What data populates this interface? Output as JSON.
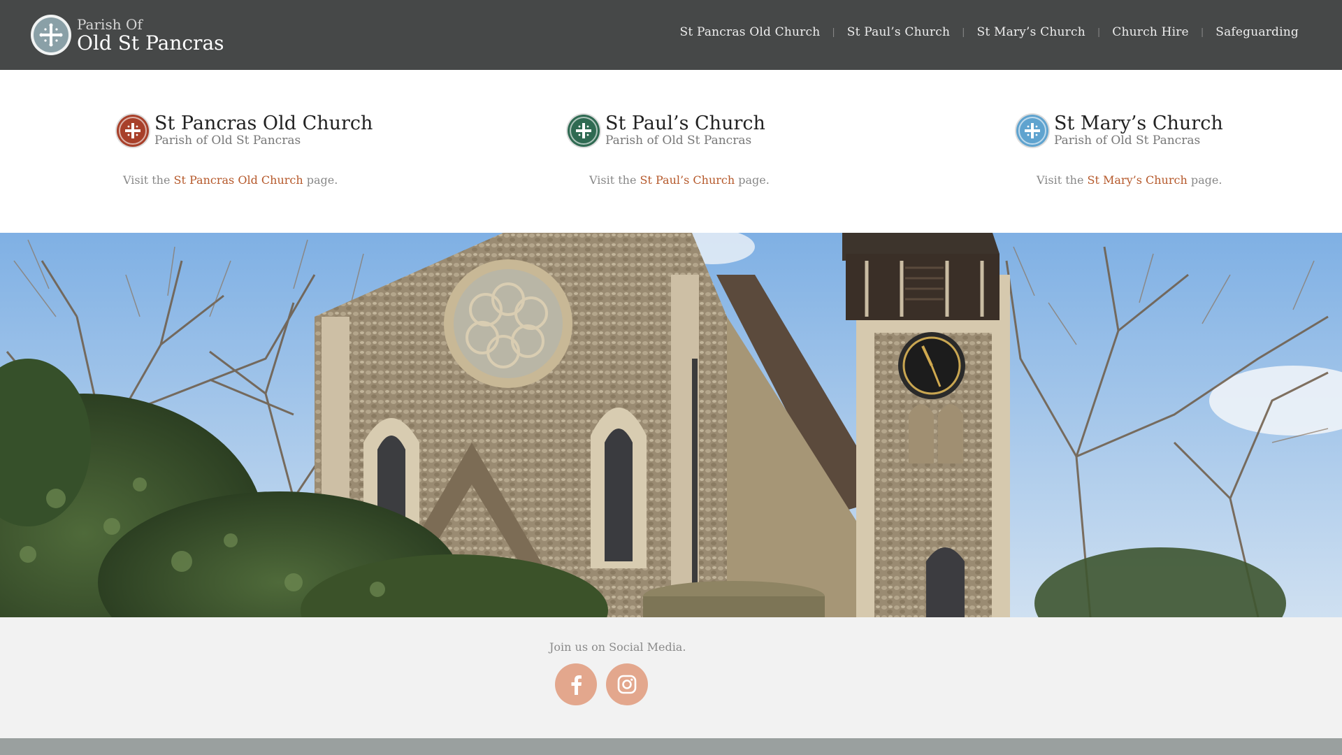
{
  "header": {
    "brand_small": "Parish Of",
    "brand_big": "Old St Pancras",
    "nav": [
      {
        "label": "St Pancras Old Church"
      },
      {
        "label": "St Paul’s Church"
      },
      {
        "label": "St Mary’s Church"
      },
      {
        "label": "Church Hire"
      },
      {
        "label": "Safeguarding"
      }
    ],
    "separator": "|"
  },
  "churches": [
    {
      "title": "St Pancras Old Church",
      "subtitle": "Parish of Old St Pancras",
      "visit_prefix": "Visit the",
      "link": "St Pancras Old Church",
      "visit_suffix": "page.",
      "badge_color": "#a8402a",
      "icon": "cross-icon"
    },
    {
      "title": "St Paul’s Church",
      "subtitle": "Parish of Old St Pancras",
      "visit_prefix": "Visit the",
      "link": "St Paul’s Church",
      "visit_suffix": "page.",
      "badge_color": "#2f6a52",
      "icon": "cross-icon"
    },
    {
      "title": "St Mary’s Church",
      "subtitle": "Parish of Old St Pancras",
      "visit_prefix": "Visit the",
      "link": "St Mary’s Church",
      "visit_suffix": "page.",
      "badge_color": "#5fa3cf",
      "icon": "cross-icon"
    }
  ],
  "photo": {
    "icon": "church-photo"
  },
  "social": {
    "title": "Join us on Social Media.",
    "buttons": [
      {
        "icon": "facebook-icon"
      },
      {
        "icon": "instagram-icon"
      }
    ]
  },
  "colors": {
    "header_bg": "#464848",
    "link": "#b5582a",
    "social_btn": "#e3a78d",
    "footer_bg": "#f2f2f2"
  }
}
